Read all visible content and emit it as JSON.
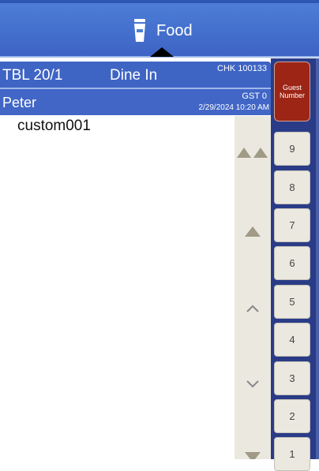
{
  "header": {
    "tab_label": "Food",
    "tab_icon": "cup-icon"
  },
  "check": {
    "table": "TBL 20/1",
    "order_type": "Dine In",
    "chk": "CHK 100133",
    "server": "Peter",
    "guests": "GST 0",
    "datetime": "2/29/2024 10:20 AM"
  },
  "items": [
    "custom001"
  ],
  "guest_button": {
    "line1": "Guest",
    "line2": "Number"
  },
  "number_pad": [
    "9",
    "8",
    "7",
    "6",
    "5",
    "4",
    "3",
    "2",
    "1"
  ],
  "colors": {
    "header": "#4d7fd8",
    "panel": "#2a3c87",
    "guest_button": "#9c2516",
    "scroll": "#ebe8e0"
  }
}
